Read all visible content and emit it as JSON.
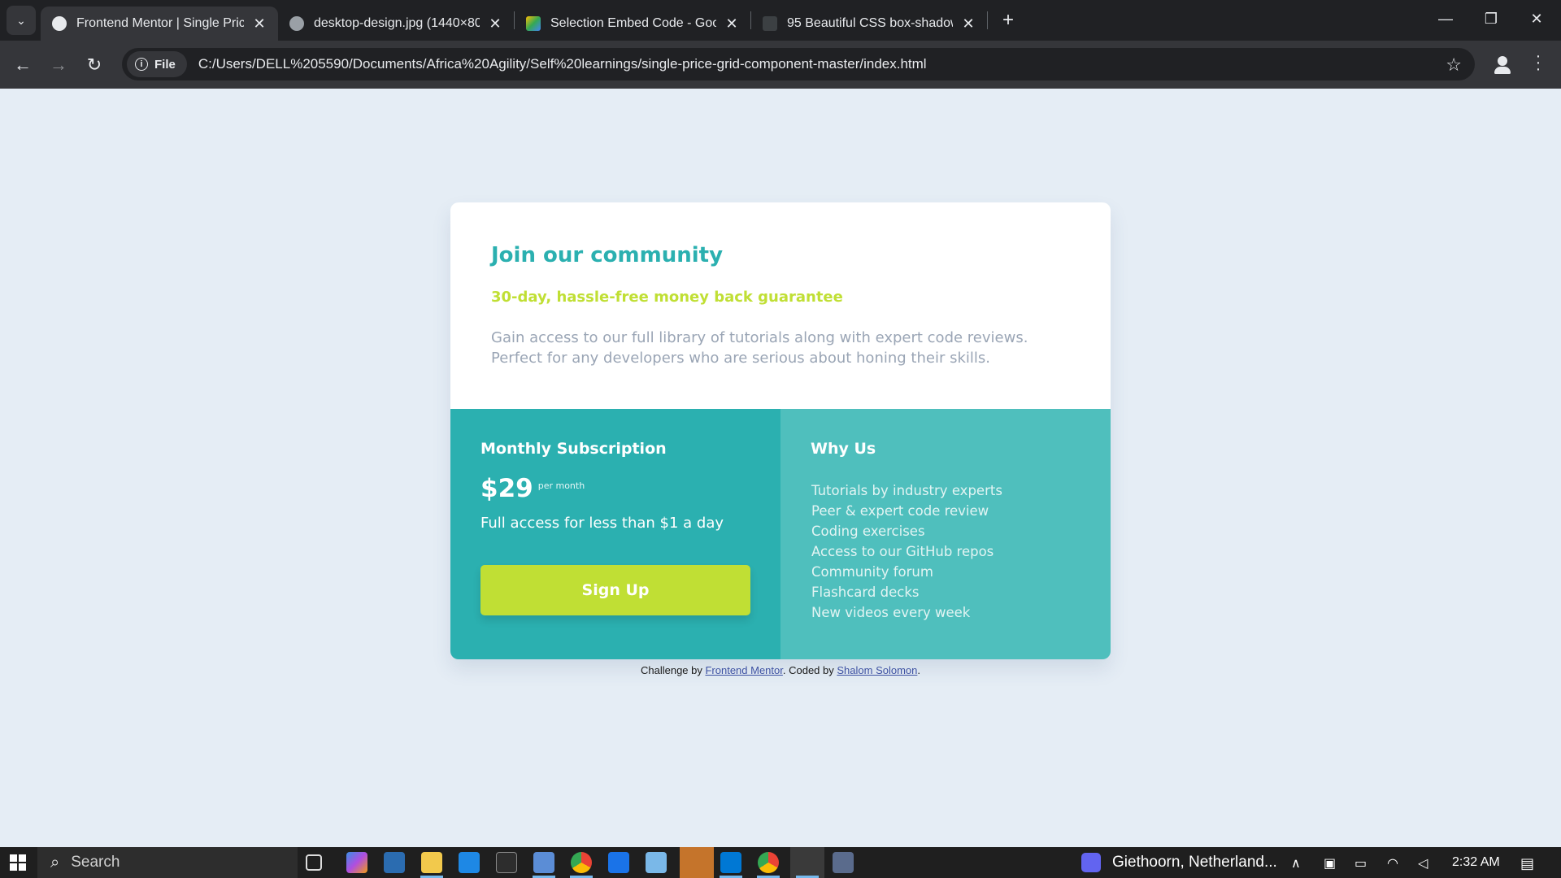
{
  "browser": {
    "tabs": [
      {
        "title": "Frontend Mentor | Single Price Grid",
        "active": true
      },
      {
        "title": "desktop-design.jpg (1440×800)",
        "active": false
      },
      {
        "title": "Selection Embed Code - Google",
        "active": false
      },
      {
        "title": "95 Beautiful CSS box-shadow examples",
        "active": false
      }
    ],
    "site_chip": "File",
    "url": "C:/Users/DELL%205590/Documents/Africa%20Agility/Self%20learnings/single-price-grid-component-master/index.html"
  },
  "card": {
    "title": "Join our community",
    "subtitle": "30-day, hassle-free money back guarantee",
    "description": "Gain access to our full library of tutorials along with expert code reviews. Perfect for any developers who are serious about honing their skills.",
    "subscription": {
      "heading": "Monthly Subscription",
      "price": "$29",
      "price_unit": "per month",
      "tagline": "Full access for less than $1 a day",
      "button": "Sign Up"
    },
    "why_us": {
      "heading": "Why Us",
      "items": [
        "Tutorials by industry experts",
        "Peer & expert code review",
        "Coding exercises",
        "Access to our GitHub repos",
        "Community forum",
        "Flashcard decks",
        "New videos every week"
      ]
    }
  },
  "attribution": {
    "prefix": "Challenge by ",
    "link1": "Frontend Mentor",
    "middle": ". Coded by ",
    "link2": "Shalom Solomon",
    "suffix": "."
  },
  "taskbar": {
    "search_placeholder": "Search",
    "weather_location": "Giethoorn, Netherland...",
    "time": "2:32 AM"
  },
  "colors": {
    "primary_teal": "#2bb0b0",
    "light_teal": "#4fbfbd",
    "lime": "#c0df34",
    "page_bg": "#e5edf5"
  }
}
